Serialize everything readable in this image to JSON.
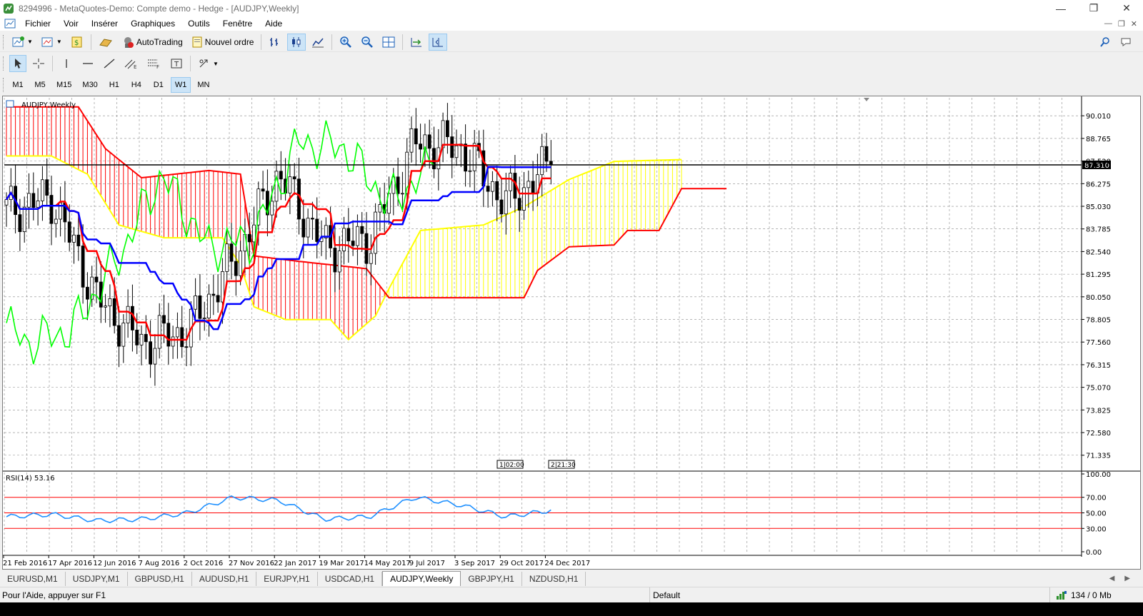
{
  "window": {
    "title": "8294996 - MetaQuotes-Demo: Compte demo - Hedge - [AUDJPY,Weekly]"
  },
  "menu": [
    "Fichier",
    "Voir",
    "Insérer",
    "Graphiques",
    "Outils",
    "Fenêtre",
    "Aide"
  ],
  "toolbar": {
    "autotrading_label": "AutoTrading",
    "new_order_label": "Nouvel ordre"
  },
  "timeframes": {
    "items": [
      "M1",
      "M5",
      "M15",
      "M30",
      "H1",
      "H4",
      "D1",
      "W1",
      "MN"
    ],
    "active": "W1"
  },
  "chart": {
    "symbol_label": "AUDJPY,Weekly",
    "current_price": "87.310",
    "price_ticks": [
      "90.010",
      "88.765",
      "87.520",
      "86.275",
      "85.030",
      "83.785",
      "82.540",
      "81.295",
      "80.050",
      "78.805",
      "77.560",
      "76.315",
      "75.070",
      "73.825",
      "72.580",
      "71.335"
    ],
    "date_ticks": [
      "21 Feb 2016",
      "17 Apr 2016",
      "12 Jun 2016",
      "7 Aug 2016",
      "2 Oct 2016",
      "27 Nov 2016",
      "22 Jan 2017",
      "19 Mar 2017",
      "14 May 2017",
      "9 Jul 2017",
      "3 Sep 2017",
      "29 Oct 2017",
      "24 Dec 2017"
    ],
    "event_markers": [
      {
        "num": "1",
        "time": "02:00"
      },
      {
        "num": "2",
        "time": "21:30"
      }
    ],
    "rsi_label": "RSI(14) 53.16",
    "rsi_ticks": [
      "100.00",
      "70.00",
      "50.00",
      "30.00",
      "0.00"
    ],
    "colors": {
      "bull_candle": "#ffffff",
      "bear_candle": "#000000",
      "tenkan": "#ff0000",
      "kijun": "#0000ff",
      "chikou": "#00ff00",
      "kumo_bull": "#ffff00",
      "kumo_bear": "#ff0000",
      "rsi_line": "#1e90ff",
      "rsi_levels": "#ff0000"
    }
  },
  "chart_data": {
    "type": "candlestick",
    "title": "AUDJPY,Weekly",
    "x": [
      "21 Feb 2016",
      "17 Apr 2016",
      "12 Jun 2016",
      "7 Aug 2016",
      "2 Oct 2016",
      "27 Nov 2016",
      "22 Jan 2017",
      "19 Mar 2017",
      "14 May 2017",
      "9 Jul 2017",
      "3 Sep 2017",
      "29 Oct 2017",
      "24 Dec 2017"
    ],
    "series": [
      {
        "values": [
          84.8,
          85.5,
          79.9,
          77.5,
          78.2,
          82.0,
          86.8,
          82.8,
          83.2,
          88.5,
          88.3,
          85.2,
          87.31
        ]
      },
      {
        "name": "RSI(14)",
        "values": [
          45,
          48,
          40,
          42,
          50,
          70,
          66,
          42,
          45,
          70,
          60,
          45,
          53.16
        ]
      }
    ],
    "ylim": [
      70.5,
      91.0
    ],
    "rsi_ylim": [
      0,
      100
    ],
    "rsi_levels": [
      70,
      50,
      30
    ],
    "current_price": 87.31
  },
  "tabs": {
    "items": [
      "EURUSD,M1",
      "USDJPY,M1",
      "GBPUSD,H1",
      "AUDUSD,H1",
      "EURJPY,H1",
      "USDCAD,H1",
      "AUDJPY,Weekly",
      "GBPJPY,H1",
      "NZDUSD,H1"
    ],
    "active": "AUDJPY,Weekly"
  },
  "status": {
    "help": "Pour l'Aide, appuyer sur F1",
    "profile": "Default",
    "connection": "134 / 0 Mb"
  }
}
